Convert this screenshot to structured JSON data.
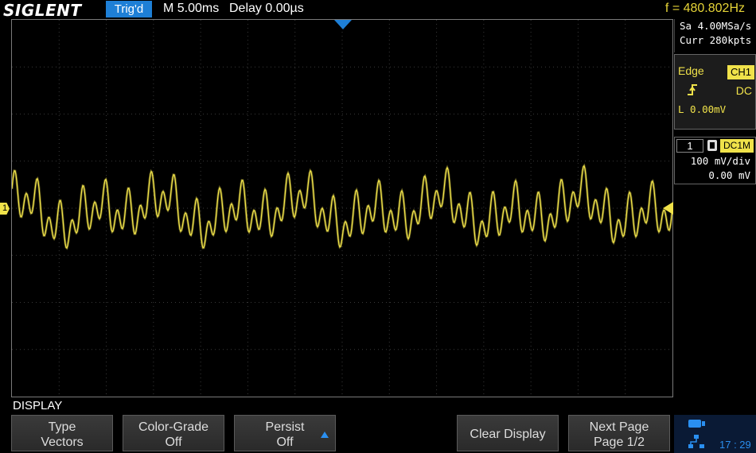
{
  "topbar": {
    "logo": "SIGLENT",
    "trigger_status": "Trig'd",
    "timebase": "M 5.00ms",
    "delay": "Delay 0.00µs",
    "frequency": "f = 480.802Hz"
  },
  "acquisition": {
    "sample_rate": "Sa 4.00MSa/s",
    "memory": "Curr 280kpts"
  },
  "trigger": {
    "type": "Edge",
    "source": "CH1",
    "coupling": "DC",
    "level": "L  0.00mV"
  },
  "channel": {
    "number": "1",
    "impedance_coupling": "DC1M",
    "scale": "100 mV/div",
    "offset": "0.00 mV",
    "marker_label": "1"
  },
  "menu": {
    "title": "DISPLAY",
    "softkeys": [
      {
        "line1": "Type",
        "line2": "Vectors"
      },
      {
        "line1": "Color-Grade",
        "line2": "Off"
      },
      {
        "line1": "Persist",
        "line2": "Off"
      },
      {
        "line1": "Clear Display",
        "line2": ""
      },
      {
        "line1": "Next Page",
        "line2": "Page 1/2"
      }
    ]
  },
  "status": {
    "clock": "17 : 29"
  },
  "colors": {
    "trace": "#f0e24a",
    "accent": "#1e7fd6",
    "frequency": "#e6d437"
  }
}
